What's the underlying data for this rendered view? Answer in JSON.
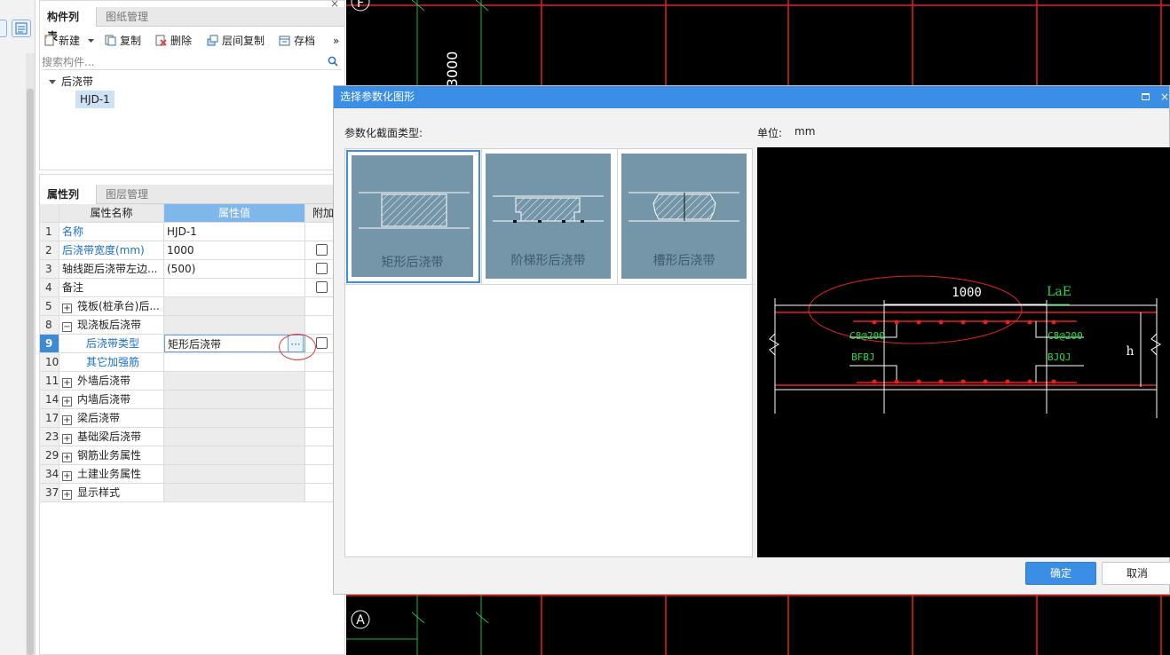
{
  "component_panel": {
    "tabs": [
      "构件列表",
      "图纸管理"
    ],
    "toolbar": {
      "new": "新建",
      "copy": "复制",
      "delete": "删除",
      "floor_copy": "层间复制",
      "archive": "存档",
      "more": "»"
    },
    "search_placeholder": "搜索构件...",
    "tree": {
      "root": "后浇带",
      "child": "HJD-1"
    }
  },
  "property_panel": {
    "tabs": [
      "属性列表",
      "图层管理"
    ],
    "columns": [
      "属性名称",
      "属性值",
      "附加"
    ],
    "rows": [
      {
        "num": "1",
        "name": "名称",
        "value": "HJD-1"
      },
      {
        "num": "2",
        "name": "后浇带宽度(mm)",
        "value": "1000"
      },
      {
        "num": "3",
        "name": "轴线距后浇带左边...",
        "value": "(500)"
      },
      {
        "num": "4",
        "name": "备注",
        "value": ""
      },
      {
        "num": "5",
        "name": "筏板(桩承台)后...",
        "value": ""
      },
      {
        "num": "8",
        "name": "现浇板后浇带",
        "value": ""
      },
      {
        "num": "9",
        "name": "后浇带类型",
        "value": "矩形后浇带"
      },
      {
        "num": "10",
        "name": "其它加强筋",
        "value": ""
      },
      {
        "num": "11",
        "name": "外墙后浇带",
        "value": ""
      },
      {
        "num": "14",
        "name": "内墙后浇带",
        "value": ""
      },
      {
        "num": "17",
        "name": "梁后浇带",
        "value": ""
      },
      {
        "num": "23",
        "name": "基础梁后浇带",
        "value": ""
      },
      {
        "num": "29",
        "name": "钢筋业务属性",
        "value": ""
      },
      {
        "num": "34",
        "name": "土建业务属性",
        "value": ""
      },
      {
        "num": "37",
        "name": "显示样式",
        "value": ""
      }
    ],
    "expand_sign": "+",
    "collapse_sign": "−",
    "dots": "···"
  },
  "cad": {
    "axis_top": "F",
    "axis_bottom": "A",
    "dim_text": "3000"
  },
  "dialog": {
    "title": "选择参数化图形",
    "close": "×",
    "section_label": "参数化截面类型:",
    "unit_label": "单位:",
    "unit_value": "mm",
    "shapes": [
      "矩形后浇带",
      "阶梯形后浇带",
      "槽形后浇带"
    ],
    "preview": {
      "width": "1000",
      "lae": "LaE",
      "left_rebar": "C8@200",
      "right_rebar": "C8@200",
      "left_code": "BFBJ",
      "right_code": "BJQJ",
      "h": "h"
    },
    "ok": "确定",
    "cancel": "取消"
  },
  "colors": {
    "accent": "#3a8ee6",
    "grid_red": "#e52020",
    "grid_green": "#19b84a",
    "rebar_green": "#22dd44"
  }
}
